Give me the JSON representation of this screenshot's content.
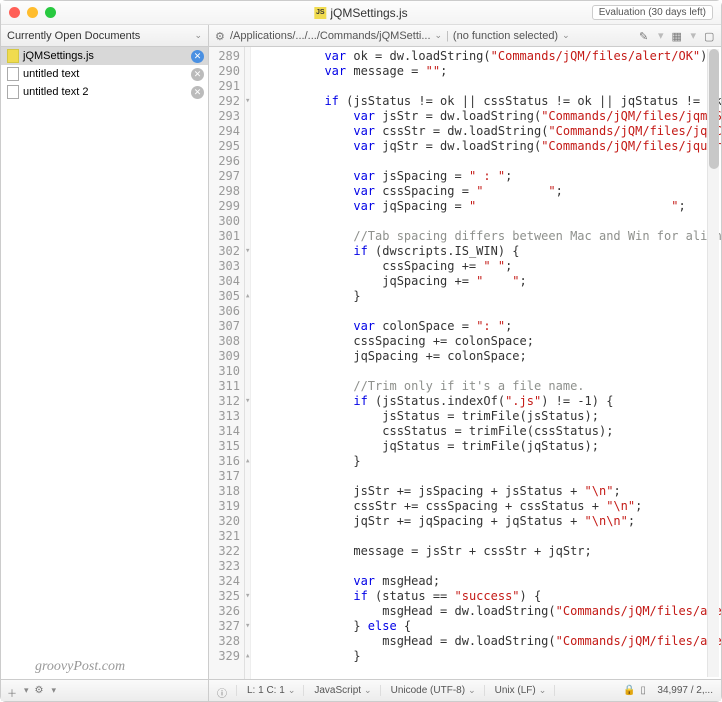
{
  "window": {
    "title": "jQMSettings.js",
    "eval_badge": "Evaluation (30 days left)"
  },
  "sidebar_header": "Currently Open Documents",
  "toolbar": {
    "path": "/Applications/.../.../Commands/jQMSetti...",
    "func": "(no function selected)"
  },
  "documents": [
    {
      "name": "jQMSettings.js",
      "active": true,
      "js": true
    },
    {
      "name": "untitled text",
      "active": false,
      "js": false
    },
    {
      "name": "untitled text 2",
      "active": false,
      "js": false
    }
  ],
  "code_lines": [
    {
      "n": 289,
      "f": "",
      "h": "         <span class='kw'>var</span> ok = dw.loadString(<span class='str'>\"Commands/jQM/files/alert/OK\"</span>);"
    },
    {
      "n": 290,
      "f": "",
      "h": "         <span class='kw'>var</span> message = <span class='str'>\"\"</span>;"
    },
    {
      "n": 291,
      "f": "",
      "h": ""
    },
    {
      "n": 292,
      "f": "▾",
      "h": "         <span class='kw'>if</span> (jsStatus != ok || cssStatus != ok || jqStatus != ok"
    },
    {
      "n": 293,
      "f": "",
      "h": "             <span class='kw'>var</span> jsStr = dw.loadString(<span class='str'>\"Commands/jQM/files/jqmJS\"</span>"
    },
    {
      "n": 294,
      "f": "",
      "h": "             <span class='kw'>var</span> cssStr = dw.loadString(<span class='str'>\"Commands/jQM/files/jqmC\"</span>"
    },
    {
      "n": 295,
      "f": "",
      "h": "             <span class='kw'>var</span> jqStr = dw.loadString(<span class='str'>\"Commands/jQM/files/jquer\"</span>"
    },
    {
      "n": 296,
      "f": "",
      "h": ""
    },
    {
      "n": 297,
      "f": "",
      "h": "             <span class='kw'>var</span> jsSpacing = <span class='str'>\" : \"</span>;"
    },
    {
      "n": 298,
      "f": "",
      "h": "             <span class='kw'>var</span> cssSpacing = <span class='str'>\"         \"</span>;"
    },
    {
      "n": 299,
      "f": "",
      "h": "             <span class='kw'>var</span> jqSpacing = <span class='str'>\"                           \"</span>;"
    },
    {
      "n": 300,
      "f": "",
      "h": ""
    },
    {
      "n": 301,
      "f": "",
      "h": "             <span class='com'>//Tab spacing differs between Mac and Win for align</span>"
    },
    {
      "n": 302,
      "f": "▾",
      "h": "             <span class='kw'>if</span> (dwscripts.IS_WIN) {"
    },
    {
      "n": 303,
      "f": "",
      "h": "                 cssSpacing += <span class='str'>\" \"</span>;"
    },
    {
      "n": 304,
      "f": "",
      "h": "                 jqSpacing += <span class='str'>\"    \"</span>;"
    },
    {
      "n": 305,
      "f": "▴",
      "h": "             }"
    },
    {
      "n": 306,
      "f": "",
      "h": ""
    },
    {
      "n": 307,
      "f": "",
      "h": "             <span class='kw'>var</span> colonSpace = <span class='str'>\": \"</span>;"
    },
    {
      "n": 308,
      "f": "",
      "h": "             cssSpacing += colonSpace;"
    },
    {
      "n": 309,
      "f": "",
      "h": "             jqSpacing += colonSpace;"
    },
    {
      "n": 310,
      "f": "",
      "h": ""
    },
    {
      "n": 311,
      "f": "",
      "h": "             <span class='com'>//Trim only if it's a file name.</span>"
    },
    {
      "n": 312,
      "f": "▾",
      "h": "             <span class='kw'>if</span> (jsStatus.indexOf(<span class='str'>\".js\"</span>) != -1) {"
    },
    {
      "n": 313,
      "f": "",
      "h": "                 jsStatus = trimFile(jsStatus);"
    },
    {
      "n": 314,
      "f": "",
      "h": "                 cssStatus = trimFile(cssStatus);"
    },
    {
      "n": 315,
      "f": "",
      "h": "                 jqStatus = trimFile(jqStatus);"
    },
    {
      "n": 316,
      "f": "▴",
      "h": "             }"
    },
    {
      "n": 317,
      "f": "",
      "h": ""
    },
    {
      "n": 318,
      "f": "",
      "h": "             jsStr += jsSpacing + jsStatus + <span class='str'>\"\\n\"</span>;"
    },
    {
      "n": 319,
      "f": "",
      "h": "             cssStr += cssSpacing + cssStatus + <span class='str'>\"\\n\"</span>;"
    },
    {
      "n": 320,
      "f": "",
      "h": "             jqStr += jqSpacing + jqStatus + <span class='str'>\"\\n\\n\"</span>;"
    },
    {
      "n": 321,
      "f": "",
      "h": ""
    },
    {
      "n": 322,
      "f": "",
      "h": "             message = jsStr + cssStr + jqStr;"
    },
    {
      "n": 323,
      "f": "",
      "h": ""
    },
    {
      "n": 324,
      "f": "",
      "h": "             <span class='kw'>var</span> msgHead;"
    },
    {
      "n": 325,
      "f": "▾",
      "h": "             <span class='kw'>if</span> (status == <span class='str'>\"success\"</span>) {"
    },
    {
      "n": 326,
      "f": "",
      "h": "                 msgHead = dw.loadString(<span class='str'>\"Commands/jQM/files/ale\"</span>"
    },
    {
      "n": 327,
      "f": "▾",
      "h": "             } <span class='kw'>else</span> {"
    },
    {
      "n": 328,
      "f": "",
      "h": "                 msgHead = dw.loadString(<span class='str'>\"Commands/jQM/files/ale\"</span>"
    },
    {
      "n": 329,
      "f": "▴",
      "h": "             }"
    }
  ],
  "status": {
    "cursor": "L: 1 C: 1",
    "lang": "JavaScript",
    "encoding": "Unicode (UTF-8)",
    "lineend": "Unix (LF)",
    "size": "34,997 / 2,..."
  },
  "watermark": "groovyPost.com"
}
